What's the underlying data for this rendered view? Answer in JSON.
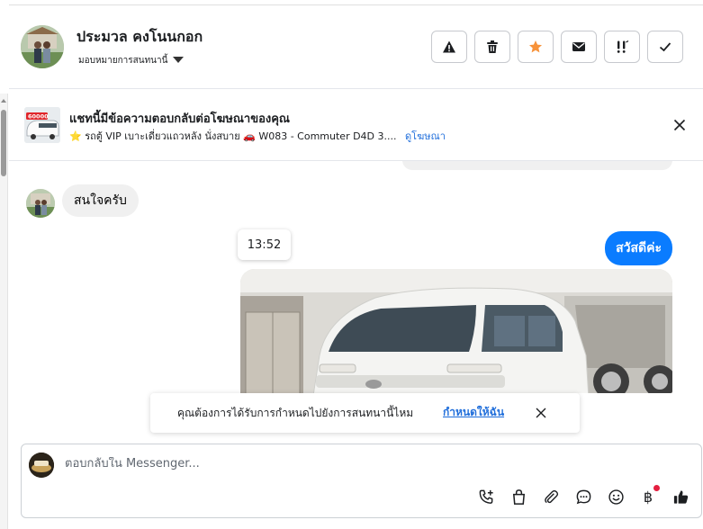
{
  "contact": {
    "name": "ประมวล คงโนนกอก",
    "assign_label": "มอบหมายการสนทนานี้"
  },
  "header_actions": [
    {
      "icon": "warning-icon"
    },
    {
      "icon": "trash-icon"
    },
    {
      "icon": "star-icon"
    },
    {
      "icon": "mail-icon"
    },
    {
      "icon": "follow-up-icon"
    },
    {
      "icon": "check-icon"
    }
  ],
  "ad": {
    "title": "แชทนี้มีข้อความตอบกลับต่อโฆษณาของคุณ",
    "subtitle": "⭐ รถตู้ VIP เบาะเดี่ยวแถวหลัง นั่งสบาย 🚗 W083 - Commuter D4D 3....",
    "link_label": "ดูโฆษณา",
    "thumb_price": "60000"
  },
  "messages": {
    "incoming_text": "สนใจครับ",
    "timestamp": "13:52",
    "outgoing_text": "สวัสดีค่ะ"
  },
  "toast": {
    "text": "คุณต้องการได้รับการกำหนดไปยังการสนทนานี้ไหม",
    "link_label": "กำหนดให้ฉัน"
  },
  "composer": {
    "placeholder": "ตอบกลับใน Messenger...",
    "currency_symbol": "฿"
  },
  "colors": {
    "accent": "#0a7cff",
    "link": "#216fdb",
    "star": "#f7923a",
    "notification": "#e41e3f"
  }
}
